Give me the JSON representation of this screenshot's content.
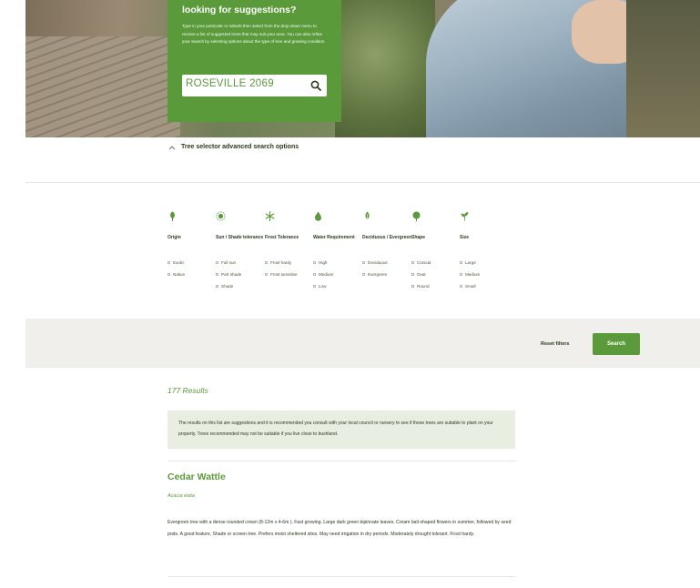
{
  "hero": {
    "title": "looking for suggestions?",
    "description": "Type in your postcode or suburb then select from the drop down menu to receive a list of suggested trees that may suit your area. You can also refine your search by selecting options about the type of tree and growing condition.",
    "search_value": "ROSEVILLE 2069",
    "search_icon": "search-icon"
  },
  "advanced": {
    "label": "Tree selector advanced search options",
    "icon": "chevron-up-icon"
  },
  "filters": [
    {
      "icon": "tree-icon",
      "heading": "Origin",
      "options": [
        "Exotic",
        "Native"
      ]
    },
    {
      "icon": "sun-icon",
      "heading": "Sun / Shade tolerance",
      "options": [
        "Full sun",
        "Part shade",
        "Shade"
      ]
    },
    {
      "icon": "snowflake-icon",
      "heading": "Frost Tolerance",
      "options": [
        "Frost hardy",
        "Frost sensitive"
      ]
    },
    {
      "icon": "water-drop-icon",
      "heading": "Water Requirement",
      "options": [
        "High",
        "Medium",
        "Low"
      ]
    },
    {
      "icon": "leaf-icon",
      "heading": "Deciduous / Evergreen",
      "options": [
        "Deciduous",
        "Evergreen"
      ]
    },
    {
      "icon": "tree-shape-icon",
      "heading": "Shape",
      "options": [
        "Conical",
        "Oval",
        "Round"
      ]
    },
    {
      "icon": "sprout-icon",
      "heading": "Size",
      "options": [
        "Large",
        "Medium",
        "Small"
      ]
    }
  ],
  "actions": {
    "reset_label": "Reset filters",
    "search_label": "Search"
  },
  "results": {
    "count_label": "177 Results",
    "notice": "The results on this list are suggestions and it is recommended you consult with your local council or nursery to see if these trees are suitable to plant on your property. Trees recommended may not be suitable if you live close to bushland.",
    "items": [
      {
        "name": "Cedar Wattle",
        "scientific": "Acacia elata",
        "description": "Evergreen tree with a dense rounded crown (8-12m x 4-6m ). Fast growing. Large dark green bipinnate leaves. Cream ball-shaped flowers in summer, followed by seed pods. A good feature, Shade or screen tree. Prefers moist sheltered sites. May need irrigation in dry periods. Moderately drought tolerant. Frost hardy."
      }
    ]
  },
  "colors": {
    "brand_green": "#5a9a3a",
    "bar_bg": "#f1efec",
    "notice_bg": "#e9eee3"
  }
}
